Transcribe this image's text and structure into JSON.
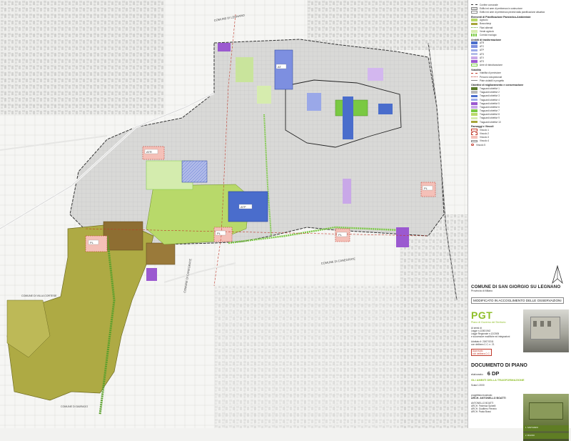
{
  "map": {
    "street_labels": [
      "COMUNE DI LEGNANO",
      "COMUNE DI CANEGRATE",
      "COMUNE DI CANEGRATE",
      "COMUNE DI VILLA CORTESE",
      "COMUNE DI DAIRAGO"
    ],
    "area_tags": [
      "ATR",
      "PL",
      "PL",
      "PL",
      "ATP",
      "PL",
      "AT"
    ]
  },
  "legend": {
    "top_items": [
      "Confine comunale",
      "Edifici ed aree di pertinenza in costruzione",
      "Edifici ed aree di pertinenza previsti dalla pianificazione attuativa"
    ],
    "section_paesistico": "Elementi di Pianificazione Paesistico-Ambientale",
    "paesistico_items": [
      "Agricolo",
      "Bosco/siepi",
      "Filari alberati",
      "Verde agricolo",
      "Corridoi ecologici"
    ],
    "section_trasformazione": "Ambiti di trasformazione",
    "trasformazione_items": [
      "ATR",
      "ATC",
      "ATP",
      "ATS",
      "ATV",
      "ATS",
      "Aree di ristrutturazione"
    ],
    "section_viabilita": "Viabilità",
    "viabilita_items": [
      "Viabilità di previsione",
      "Percorsi ciclopedonali",
      "Piste ciclabili in progetto"
    ],
    "section_miglioramento": "Obiettivi di miglioramento e conservazione",
    "miglioramento_items": [
      "Traguardi obiettivi 1",
      "Traguardi obiettivi 2",
      "Traguardi obiettivi 3",
      "Traguardi obiettivi 4",
      "Traguardi obiettivi 5",
      "Traguardi obiettivi 6",
      "Traguardi obiettivi 7",
      "Traguardi obiettivi 8",
      "Traguardi obiettivi 9",
      "Traguardi obiettivi 10"
    ],
    "section_vincoli": "Paesaggi e Vincoli",
    "vincoli_items": [
      "Vincolo 1",
      "Vincolo 2",
      "Vincolo 3",
      "Vincolo 4",
      "Vincolo 5"
    ],
    "colors": {
      "agricolo": "#b8d96a",
      "bosco": "#a7a53a",
      "brown": "#9a7a3a",
      "blue": "#4a6dcc",
      "lightblue": "#9aa8e8",
      "purple": "#9b59d0",
      "lilac": "#c9a8e8",
      "pink": "#f4c0b8",
      "green": "#7ac943",
      "lightgreen": "#d6ecae"
    }
  },
  "titleblock": {
    "comune": "COMUNE DI SAN GIORGIO SU LEGNANO",
    "provincia": "Provincia di Milano",
    "stamp": "MODIFICATO IN ACCOGLIMENTO DELLE OSSERVAZIONI",
    "pgt": "PGT",
    "pgt_sub": "Piano di Governo del Territorio",
    "law_lines": [
      "Ai sensi di:",
      "Legge n.1150/1942",
      "Legge Regionale n.12/2005",
      "e successive modifiche ed integrazioni"
    ],
    "adoption": [
      "Adottato il: 23/07/2011",
      "con delibera C.C. n. 21"
    ],
    "approval": [
      "Approvato",
      "con delibera C.C."
    ],
    "documento": "DOCUMENTO DI PIANO",
    "elaborato_label": "elaborato",
    "elaborato_value": "6 DP",
    "elaborato_title": "GLI AMBITI DELLA TRASFORMAZIONE",
    "scala": "Scala 1:2000",
    "progettista_label": "progettista incaricato",
    "progettista": "ARCH. ANTONELLO BOATTI",
    "team": [
      "ANTONELLO BOATTI",
      "ARCH. Federica Spinelli",
      "ARCH. Gualtiero Ferrario",
      "ARCH. Paola Bossi"
    ],
    "photo_labels": [
      "1. SANTUARIO",
      "2. MULINO"
    ]
  }
}
